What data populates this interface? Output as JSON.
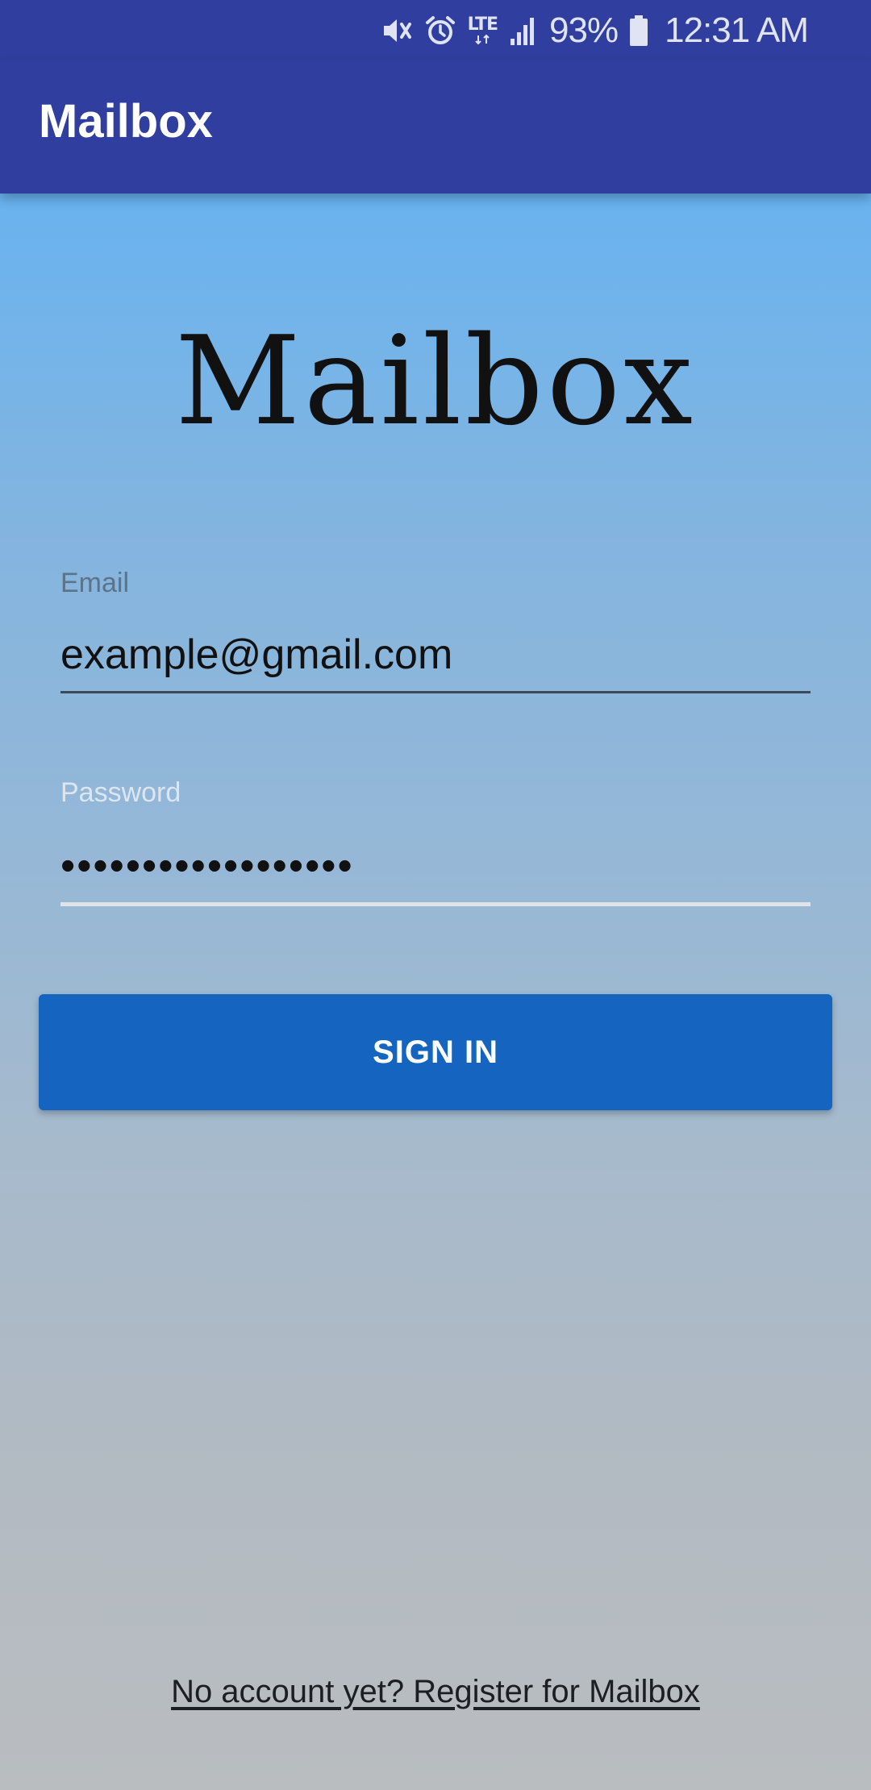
{
  "status_bar": {
    "icons": [
      "mute-icon",
      "alarm-icon",
      "lte-data-icon",
      "signal-icon",
      "battery-icon"
    ],
    "network": "LTE",
    "battery_percent": "93%",
    "time": "12:31 AM"
  },
  "app_bar": {
    "title": "Mailbox",
    "color": "#303f9f"
  },
  "logo": {
    "text": "Mailbox"
  },
  "form": {
    "email": {
      "label": "Email",
      "value": "example@gmail.com"
    },
    "password": {
      "label": "Password",
      "value": "••••••••••••••••••"
    },
    "sign_in_label": "SIGN IN",
    "button_color": "#1565c0"
  },
  "register_link": "No account yet? Register for Mailbox"
}
